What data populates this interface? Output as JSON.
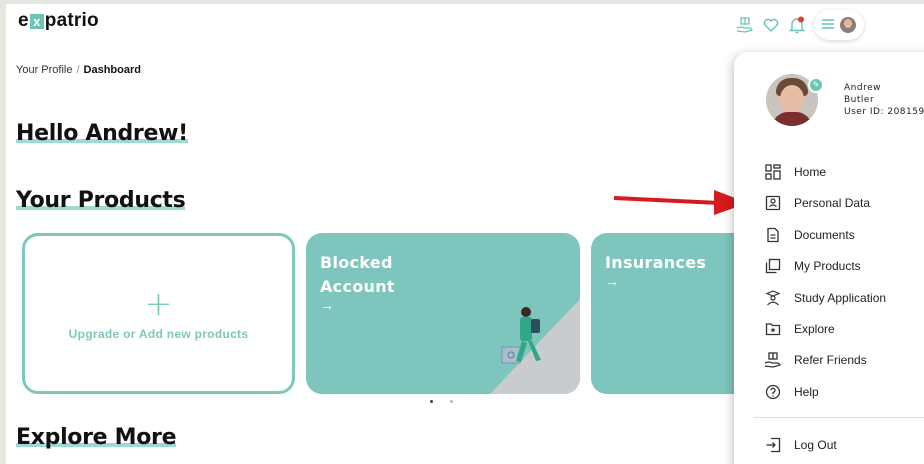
{
  "header": {
    "logo_text": [
      "e",
      "x",
      "patrio"
    ],
    "icons": [
      "gift-hand-icon",
      "heart-icon",
      "bell-icon",
      "hamburger-menu-icon",
      "user-avatar"
    ],
    "notification_color": "#e53935"
  },
  "breadcrumb": {
    "parent": "Your Profile",
    "separator": "/",
    "current": "Dashboard"
  },
  "greeting": "Hello Andrew!",
  "products": {
    "title": "Your Products",
    "add_card_label": "Upgrade or Add new products",
    "add_card_plus": "+",
    "cards": [
      {
        "title_line1": "Blocked",
        "title_line2": "Account",
        "arrow": "→"
      },
      {
        "title_line1": "Insurances",
        "title_line2": "",
        "arrow": "→"
      }
    ],
    "carousel_dots": 2,
    "active_dot": 0
  },
  "explore": {
    "title": "Explore More"
  },
  "profile_menu": {
    "first_name": "Andrew",
    "last_name": "Butler",
    "user_id_text": "User ID: 208159",
    "items": [
      {
        "label": "Home",
        "icon": "dashboard-grid-icon"
      },
      {
        "label": "Personal Data",
        "icon": "id-card-icon"
      },
      {
        "label": "Documents",
        "icon": "document-icon"
      },
      {
        "label": "My Products",
        "icon": "copy-stack-icon"
      },
      {
        "label": "Study Application",
        "icon": "student-icon"
      },
      {
        "label": "Explore",
        "icon": "star-folder-icon"
      },
      {
        "label": "Refer Friends",
        "icon": "gift-hand-icon"
      },
      {
        "label": "Help",
        "icon": "help-circle-icon"
      }
    ],
    "logout_label": "Log Out"
  },
  "colors": {
    "accent": "#7ec6bd",
    "highlight": "#9fd9cf",
    "annotation_arrow": "#d71920"
  }
}
